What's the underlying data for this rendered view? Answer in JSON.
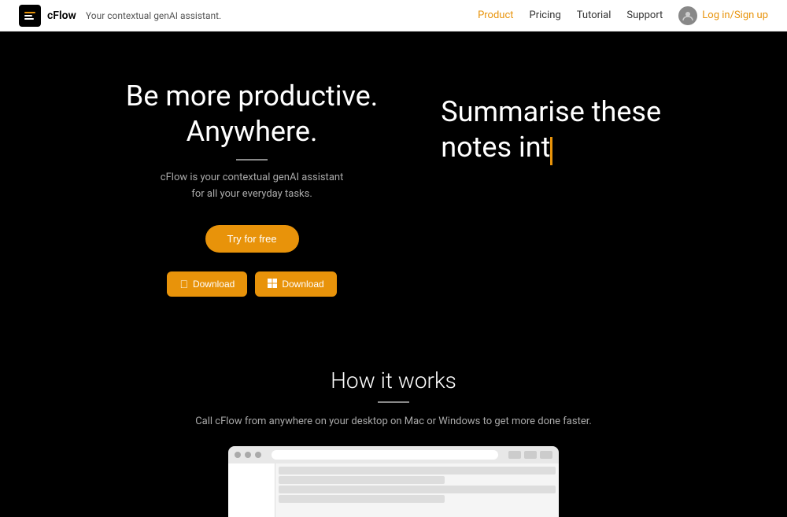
{
  "navbar": {
    "brand_icon_alt": "cFlow logo",
    "brand_name": "cFlow",
    "brand_tagline": "Your contextual genAI assistant.",
    "nav_links": [
      {
        "label": "Product",
        "active": true
      },
      {
        "label": "Pricing",
        "active": false
      },
      {
        "label": "Tutorial",
        "active": false
      },
      {
        "label": "Support",
        "active": false
      }
    ],
    "auth_label": "Log in/Sign up"
  },
  "hero": {
    "title_line1": "Be more productive.",
    "title_line2": "Anywhere.",
    "subtitle_line1": "cFlow is your contextual genAI assistant",
    "subtitle_line2": "for all your everyday tasks.",
    "try_btn": "Try for free",
    "download_mac": "Download",
    "download_win": "Download",
    "typing_line1": "Summarise these",
    "typing_line2": "notes int"
  },
  "how": {
    "title": "How it works",
    "subtitle": "Call cFlow from anywhere on your desktop on Mac or Windows to get more done faster."
  }
}
